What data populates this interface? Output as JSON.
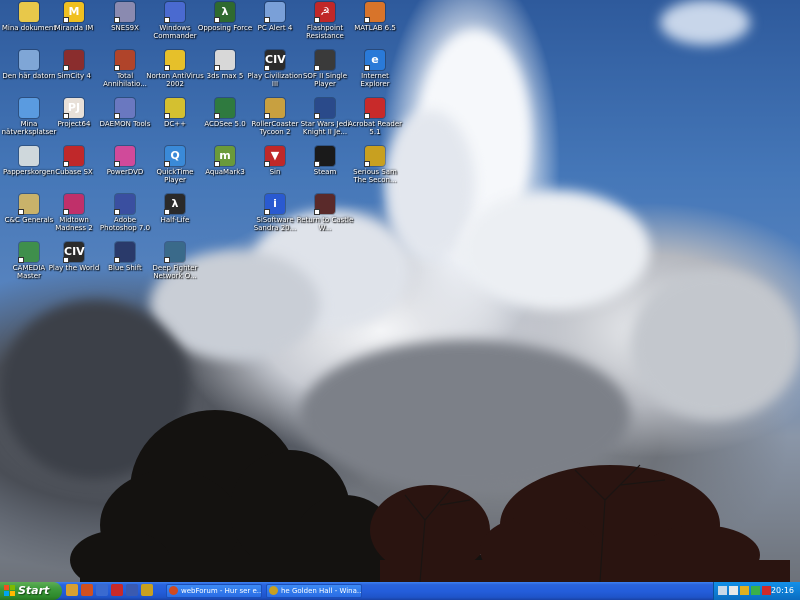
{
  "desktop": {
    "icons": [
      {
        "label": "Mina dokument",
        "icon": "folder-documents-icon",
        "color": "#e8c84a",
        "glyph": ""
      },
      {
        "label": "Den här datorn",
        "icon": "my-computer-icon",
        "color": "#7fa6d6",
        "glyph": ""
      },
      {
        "label": "Mina nätverksplatser",
        "icon": "network-places-icon",
        "color": "#5a9be0",
        "glyph": ""
      },
      {
        "label": "Papperskorgen",
        "icon": "recycle-bin-icon",
        "color": "#cfd8dc",
        "glyph": ""
      },
      {
        "label": "C&C Generals",
        "icon": "cnc-generals-icon",
        "color": "#c9b26a",
        "glyph": ""
      },
      {
        "label": "CAMEDIA Master",
        "icon": "camedia-icon",
        "color": "#3f8f4c",
        "glyph": ""
      },
      {
        "label": "Miranda IM",
        "icon": "miranda-icon",
        "color": "#f0c020",
        "glyph": "M"
      },
      {
        "label": "SimCity 4",
        "icon": "simcity-icon",
        "color": "#8a2d2d",
        "glyph": ""
      },
      {
        "label": "Project64",
        "icon": "project64-icon",
        "color": "#e8e0d8",
        "glyph": "PJ"
      },
      {
        "label": "Cubase SX",
        "icon": "cubase-icon",
        "color": "#c0282a",
        "glyph": ""
      },
      {
        "label": "Midtown Madness 2",
        "icon": "midtown-icon",
        "color": "#c0306a",
        "glyph": ""
      },
      {
        "label": "Play the World",
        "icon": "civ-play-world-icon",
        "color": "#2b2b2b",
        "glyph": "CIV"
      },
      {
        "label": "SNES9X",
        "icon": "snes9x-icon",
        "color": "#8a8ab0",
        "glyph": ""
      },
      {
        "label": "Total Annihilatio...",
        "icon": "total-annihilation-icon",
        "color": "#b0442a",
        "glyph": ""
      },
      {
        "label": "DAEMON Tools",
        "icon": "daemon-tools-icon",
        "color": "#6a78c0",
        "glyph": ""
      },
      {
        "label": "PowerDVD",
        "icon": "powerdvd-icon",
        "color": "#d04a9a",
        "glyph": ""
      },
      {
        "label": "Adobe Photoshop 7.0",
        "icon": "photoshop-icon",
        "color": "#3a4fa0",
        "glyph": ""
      },
      {
        "label": "Blue Shift",
        "icon": "blue-shift-icon",
        "color": "#2a3a6a",
        "glyph": ""
      },
      {
        "label": "Windows Commander",
        "icon": "windows-commander-icon",
        "color": "#4a6ad0",
        "glyph": ""
      },
      {
        "label": "Norton AntiVirus 2002",
        "icon": "norton-icon",
        "color": "#e6c02a",
        "glyph": ""
      },
      {
        "label": "DC++",
        "icon": "dcpp-icon",
        "color": "#d4c030",
        "glyph": ""
      },
      {
        "label": "QuickTime Player",
        "icon": "quicktime-icon",
        "color": "#3a8ad8",
        "glyph": "Q"
      },
      {
        "label": "Half-Life",
        "icon": "half-life-icon",
        "color": "#2a2a2a",
        "glyph": "λ"
      },
      {
        "label": "Deep Fighter Network O...",
        "icon": "deep-fighter-icon",
        "color": "#3a6a8a",
        "glyph": ""
      },
      {
        "label": "Opposing Force",
        "icon": "opposing-force-icon",
        "color": "#2f6a2f",
        "glyph": "λ"
      },
      {
        "label": "3ds max 5",
        "icon": "3dsmax-icon",
        "color": "#d8d8d8",
        "glyph": ""
      },
      {
        "label": "ACDSee 5.0",
        "icon": "acdsee-icon",
        "color": "#2f7a3f",
        "glyph": ""
      },
      {
        "label": "AquaMark3",
        "icon": "aquamark-icon",
        "color": "#6a9a3a",
        "glyph": "m"
      },
      {
        "label": "PC Alert 4",
        "icon": "pc-alert-icon",
        "color": "#7aa0d8",
        "glyph": ""
      },
      {
        "label": "Play Civilization III",
        "icon": "civ3-icon",
        "color": "#2b2b2b",
        "glyph": "CIV"
      },
      {
        "label": "RollerCoaster Tycoon 2",
        "icon": "rct2-icon",
        "color": "#c8a040",
        "glyph": ""
      },
      {
        "label": "Sin",
        "icon": "sin-icon",
        "color": "#c02828",
        "glyph": "▼"
      },
      {
        "label": "SiSoftware Sandra 20...",
        "icon": "sandra-icon",
        "color": "#2a5ad0",
        "glyph": "i"
      },
      {
        "label": "Flashpoint Resistance",
        "icon": "flashpoint-icon",
        "color": "#c02828",
        "glyph": "☭"
      },
      {
        "label": "SOF II Single Player",
        "icon": "sof2-icon",
        "color": "#3a3a3a",
        "glyph": ""
      },
      {
        "label": "Star Wars Jedi Knight II Je...",
        "icon": "jedi-knight-icon",
        "color": "#2a4a8a",
        "glyph": ""
      },
      {
        "label": "Steam",
        "icon": "steam-icon",
        "color": "#1a1a1a",
        "glyph": ""
      },
      {
        "label": "Return to Castle W...",
        "icon": "rtcw-icon",
        "color": "#5a2a2a",
        "glyph": ""
      },
      {
        "label": "MATLAB 6.5",
        "icon": "matlab-icon",
        "color": "#d8742a",
        "glyph": ""
      },
      {
        "label": "Internet Explorer",
        "icon": "internet-explorer-icon",
        "color": "#2a7ad8",
        "glyph": "e"
      },
      {
        "label": "Acrobat Reader 5.1",
        "icon": "acrobat-icon",
        "color": "#c82a2a",
        "glyph": ""
      },
      {
        "label": "Serious Sam The Secon...",
        "icon": "serious-sam-icon",
        "color": "#c8a020",
        "glyph": ""
      }
    ]
  },
  "taskbar": {
    "start_label": "Start",
    "quick_launch": [
      {
        "icon": "show-desktop-icon",
        "color": "#d8a030"
      },
      {
        "icon": "firefox-icon",
        "color": "#d05020"
      },
      {
        "icon": "outlook-icon",
        "color": "#3a6ad0"
      },
      {
        "icon": "opera-icon",
        "color": "#c82a2a"
      },
      {
        "icon": "save-icon",
        "color": "#3a5ab0"
      },
      {
        "icon": "winamp-icon",
        "color": "#c8a020"
      }
    ],
    "tasks": [
      {
        "label": "webForum - Hur ser e...",
        "icon": "browser-icon",
        "color": "#d04a20"
      },
      {
        "label": "he Golden Hall - Wina...",
        "icon": "winamp-icon",
        "color": "#c8a020"
      }
    ],
    "tray": [
      {
        "icon": "network-tray-icon",
        "color": "#c8d8e8"
      },
      {
        "icon": "monitor-tray-icon",
        "color": "#e8e8e8"
      },
      {
        "icon": "antivirus-tray-icon",
        "color": "#e0b020"
      },
      {
        "icon": "msn-tray-icon",
        "color": "#3ab04a"
      },
      {
        "icon": "alert-tray-icon",
        "color": "#d02a2a"
      }
    ],
    "clock": "20:16"
  }
}
